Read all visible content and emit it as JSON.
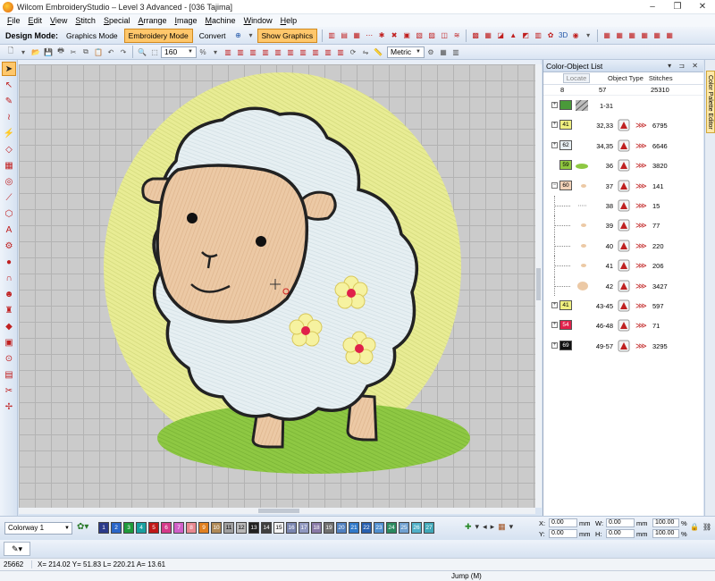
{
  "window": {
    "title": "Wilcom EmbroideryStudio – Level 3 Advanced - [036      Tajima]"
  },
  "menu": [
    {
      "label": "File",
      "u": "F",
      "rest": "ile"
    },
    {
      "label": "Edit",
      "u": "E",
      "rest": "dit"
    },
    {
      "label": "View",
      "u": "V",
      "rest": "iew"
    },
    {
      "label": "Stitch",
      "u": "S",
      "rest": "titch"
    },
    {
      "label": "Special",
      "u": "S",
      "rest": "pecial"
    },
    {
      "label": "Arrange",
      "u": "A",
      "rest": "rrange"
    },
    {
      "label": "Image",
      "u": "I",
      "rest": "mage"
    },
    {
      "label": "Machine",
      "u": "M",
      "rest": "achine"
    },
    {
      "label": "Window",
      "u": "W",
      "rest": "indow"
    },
    {
      "label": "Help",
      "u": "H",
      "rest": "elp"
    }
  ],
  "toolbar": {
    "design_mode_label": "Design Mode:",
    "graphics_mode": "Graphics Mode",
    "embroidery_mode": "Embroidery Mode",
    "convert": "Convert",
    "show_graphics": "Show Graphics",
    "zoom_value": "160",
    "units": "Metric"
  },
  "panel": {
    "title": "Color-Object List",
    "locate": "Locate",
    "col_object_type": "Object Type",
    "col_stitches": "Stitches",
    "total_colors": "8",
    "total_objects": "57",
    "total_stitches": "25310",
    "side_tab": "Color Palette Editor",
    "rows": [
      {
        "expand": "+",
        "swatch": "",
        "swatch_color": "#4a9a3a",
        "objects": "1-31",
        "stitches": "",
        "thumb": "hatch",
        "child": false
      },
      {
        "expand": "+",
        "swatch": "41",
        "swatch_color": "#f0f080",
        "objects": "32,33",
        "stitches": "6795",
        "thumb": "",
        "child": false
      },
      {
        "expand": "+",
        "swatch": "62",
        "swatch_color": "#e8f0f4",
        "objects": "34,35",
        "stitches": "6646",
        "thumb": "",
        "child": false
      },
      {
        "expand": "",
        "swatch": "59",
        "swatch_color": "#90c840",
        "objects": "36",
        "stitches": "3820",
        "thumb": "grass",
        "child": false
      },
      {
        "expand": "−",
        "swatch": "60",
        "swatch_color": "#f2d2b8",
        "objects": "37",
        "stitches": "141",
        "thumb": "dot",
        "child": false
      },
      {
        "expand": "",
        "swatch": "",
        "swatch_color": "",
        "objects": "38",
        "stitches": "15",
        "thumb": "line",
        "child": true
      },
      {
        "expand": "",
        "swatch": "",
        "swatch_color": "",
        "objects": "39",
        "stitches": "77",
        "thumb": "dot",
        "child": true
      },
      {
        "expand": "",
        "swatch": "",
        "swatch_color": "",
        "objects": "40",
        "stitches": "220",
        "thumb": "dot",
        "child": true
      },
      {
        "expand": "",
        "swatch": "",
        "swatch_color": "",
        "objects": "41",
        "stitches": "206",
        "thumb": "dot",
        "child": true
      },
      {
        "expand": "",
        "swatch": "",
        "swatch_color": "",
        "objects": "42",
        "stitches": "3427",
        "thumb": "face",
        "child": true
      },
      {
        "expand": "+",
        "swatch": "41",
        "swatch_color": "#f0f080",
        "objects": "43-45",
        "stitches": "597",
        "thumb": "",
        "child": false
      },
      {
        "expand": "+",
        "swatch": "54",
        "swatch_color": "#e0204a",
        "objects": "46-48",
        "stitches": "71",
        "thumb": "",
        "child": false
      },
      {
        "expand": "+",
        "swatch": "69",
        "swatch_color": "#111111",
        "objects": "49-57",
        "stitches": "3295",
        "thumb": "",
        "child": false
      }
    ]
  },
  "bottom": {
    "colorway": "Colorway 1",
    "palette": [
      {
        "n": "1",
        "c": "#2b3a8a"
      },
      {
        "n": "2",
        "c": "#2a66c8"
      },
      {
        "n": "3",
        "c": "#1e9a3a"
      },
      {
        "n": "4",
        "c": "#18a0a0"
      },
      {
        "n": "5",
        "c": "#c01818"
      },
      {
        "n": "6",
        "c": "#d43a8a"
      },
      {
        "n": "7",
        "c": "#d060c8"
      },
      {
        "n": "8",
        "c": "#e88890"
      },
      {
        "n": "9",
        "c": "#e08020"
      },
      {
        "n": "10",
        "c": "#b08a58"
      },
      {
        "n": "11",
        "c": "#a0a0a0"
      },
      {
        "n": "12",
        "c": "#b8b8b8"
      },
      {
        "n": "13",
        "c": "#202020"
      },
      {
        "n": "14",
        "c": "#404040"
      },
      {
        "n": "15",
        "c": "#f4f4f4"
      },
      {
        "n": "16",
        "c": "#7a86b0"
      },
      {
        "n": "17",
        "c": "#9098c0"
      },
      {
        "n": "18",
        "c": "#8a7aa8"
      },
      {
        "n": "19",
        "c": "#707070"
      },
      {
        "n": "20",
        "c": "#5080c0"
      },
      {
        "n": "21",
        "c": "#3078c8"
      },
      {
        "n": "22",
        "c": "#2860b0"
      },
      {
        "n": "23",
        "c": "#5090d0"
      },
      {
        "n": "24",
        "c": "#2a8a60"
      },
      {
        "n": "25",
        "c": "#70a0d0"
      },
      {
        "n": "26",
        "c": "#50b0c8"
      },
      {
        "n": "27",
        "c": "#40a8b8"
      }
    ],
    "x_label": "X:",
    "x_val": "0.00",
    "w_label": "W:",
    "w_val": "0.00",
    "y_label": "Y:",
    "y_val": "0.00",
    "h_label": "H:",
    "h_val": "0.00",
    "mm": "mm",
    "pct": "%",
    "scale1": "100.00",
    "scale2": "100.00"
  },
  "status": {
    "stitch_count": "25662",
    "coords": "X= 214.02 Y=  51.83 L= 220.21 A=   13.61",
    "jump": "Jump (M)"
  },
  "colors": {
    "accent": "#ffc76b",
    "panel_bg": "#ffffff",
    "canvas_bg": "#cbcbcb"
  }
}
